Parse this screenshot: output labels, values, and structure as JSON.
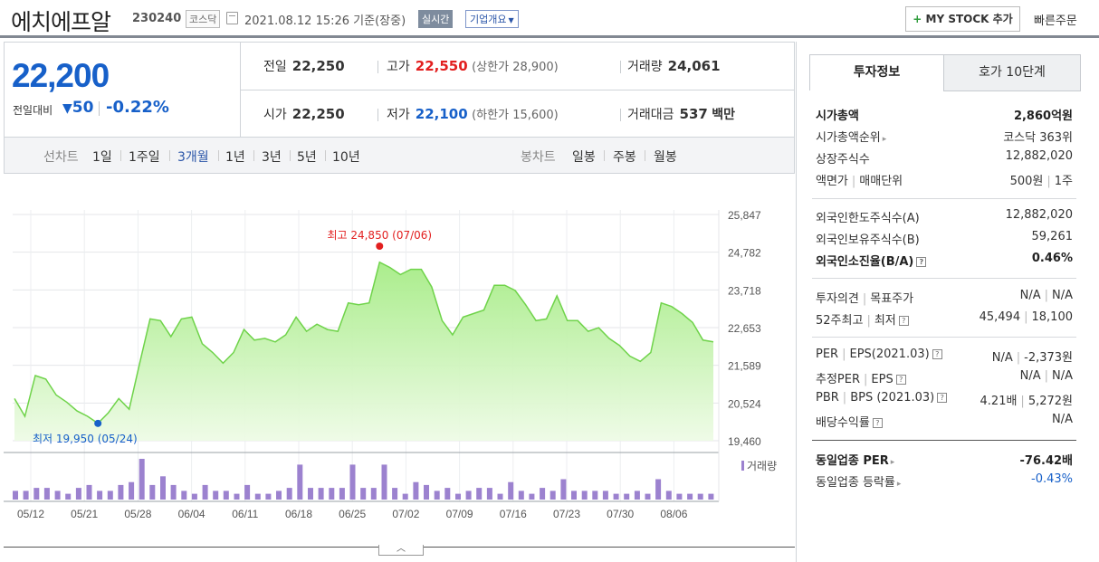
{
  "header": {
    "title": "에치에프알",
    "code": "230240",
    "market": "코스닥",
    "datetime": "2021.08.12 15:26",
    "basis": "기준(장중)",
    "realtime": "실시간",
    "company_info": "기업개요",
    "mystock_plus": "+",
    "mystock": "MY STOCK 추가",
    "quick_order": "빠른주문"
  },
  "price": {
    "current": "22,200",
    "change_label": "전일대비",
    "change_arrow": "▼",
    "change": "50",
    "change_pct": "-0.22%",
    "prev_label": "전일",
    "prev": "22,250",
    "high_label": "고가",
    "high": "22,550",
    "upper_limit": "(상한가 28,900)",
    "volume_label": "거래량",
    "volume": "24,061",
    "open_label": "시가",
    "open": "22,250",
    "low_label": "저가",
    "low": "22,100",
    "lower_limit": "(하한가 15,600)",
    "amount_label": "거래대금",
    "amount": "537",
    "amount_unit": "백만"
  },
  "period": {
    "line_label": "선차트",
    "line_items": [
      "1일",
      "1주일",
      "3개월",
      "1년",
      "3년",
      "5년",
      "10년"
    ],
    "active": "3개월",
    "candle_label": "봉차트",
    "candle_items": [
      "일봉",
      "주봉",
      "월봉"
    ]
  },
  "chart_data": {
    "type": "area",
    "title": "",
    "y_ticks": [
      "25,847",
      "24,782",
      "23,718",
      "22,653",
      "21,589",
      "20,524",
      "19,460"
    ],
    "ylim": [
      19460,
      25847
    ],
    "x_ticks": [
      "05/12",
      "05/21",
      "05/28",
      "06/04",
      "06/11",
      "06/18",
      "06/25",
      "07/02",
      "07/09",
      "07/16",
      "07/23",
      "07/30",
      "08/06"
    ],
    "high_annotation": "최고 24,850 (07/06)",
    "low_annotation": "최저 19,950 (05/24)",
    "volume_label": "거래량",
    "price_series": [
      20650,
      20150,
      21300,
      21200,
      20750,
      20550,
      20300,
      20150,
      19950,
      20250,
      20650,
      20350,
      21650,
      22900,
      22850,
      22400,
      22900,
      22950,
      22200,
      21950,
      21650,
      21950,
      22600,
      22300,
      22350,
      22250,
      22450,
      22950,
      22550,
      22750,
      22600,
      22550,
      23350,
      23300,
      23350,
      24500,
      24350,
      24150,
      24300,
      24300,
      23800,
      22850,
      22450,
      22950,
      23050,
      23150,
      23850,
      23850,
      23700,
      23300,
      22850,
      22900,
      23550,
      22850,
      22850,
      22550,
      22650,
      22350,
      22150,
      21850,
      21700,
      21950,
      23350,
      23250,
      23050,
      22800,
      22300,
      22250
    ],
    "volume_series": [
      3,
      3,
      4,
      4,
      3,
      2,
      4,
      5,
      3,
      3,
      5,
      6,
      14,
      5,
      8,
      5,
      3,
      2,
      5,
      3,
      3,
      2,
      5,
      2,
      2,
      3,
      4,
      12,
      4,
      4,
      4,
      4,
      12,
      4,
      4,
      12,
      4,
      2,
      6,
      5,
      3,
      4,
      2,
      3,
      4,
      4,
      2,
      6,
      3,
      2,
      4,
      3,
      7,
      3,
      3,
      3,
      3,
      2,
      2,
      3,
      2,
      7,
      3,
      2,
      2,
      2,
      2
    ]
  },
  "panel": {
    "tab_info": "투자정보",
    "tab_quote": "호가 10단계",
    "market_cap_label": "시가총액",
    "market_cap": "2,860억원",
    "cap_rank_label": "시가총액순위",
    "cap_rank": "코스닥 363위",
    "shares_label": "상장주식수",
    "shares": "12,882,020",
    "par_label": "액면가",
    "trade_unit_label": "매매단위",
    "par": "500원",
    "trade_unit": "1주",
    "foreign_limit_label": "외국인한도주식수(A)",
    "foreign_limit": "12,882,020",
    "foreign_hold_label": "외국인보유주식수(B)",
    "foreign_hold": "59,261",
    "foreign_ratio_label": "외국인소진율(B/A)",
    "foreign_ratio": "0.46%",
    "opinion_label": "투자의견",
    "target_label": "목표주가",
    "opinion": "N/A",
    "target": "N/A",
    "w52_label": "52주최고",
    "w52_low_label": "최저",
    "w52_high": "45,494",
    "w52_low": "18,100",
    "per_label": "PER",
    "eps_label": "EPS(2021.03)",
    "per": "N/A",
    "eps": "-2,373원",
    "est_per_label": "추정PER",
    "est_eps_label": "EPS",
    "est_per": "N/A",
    "est_eps": "N/A",
    "pbr_label": "PBR",
    "bps_label": "BPS (2021.03)",
    "pbr": "4.21배",
    "bps": "5,272원",
    "div_label": "배당수익률",
    "div": "N/A",
    "ind_per_label": "동일업종 PER",
    "ind_per": "-76.42배",
    "ind_rate_label": "동일업종 등락률",
    "ind_rate": "-0.43%",
    "qm": "?"
  }
}
